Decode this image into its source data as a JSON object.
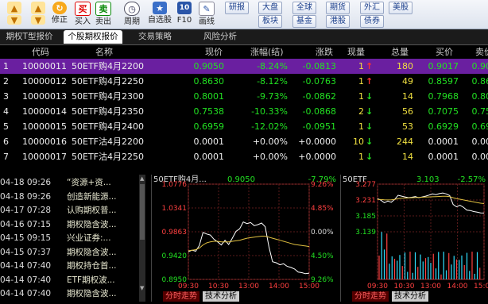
{
  "toolbar": {
    "buttons": [
      {
        "label": "",
        "icon": "arrow-up-icon"
      },
      {
        "label": "修正",
        "icon": "refresh-icon"
      },
      {
        "label": "买入",
        "icon": "buy-icon",
        "glyph": "买"
      },
      {
        "label": "卖出",
        "icon": "sell-icon",
        "glyph": "卖"
      },
      {
        "label": "周期",
        "icon": "clock-icon"
      },
      {
        "label": "自选股",
        "icon": "star-icon"
      },
      {
        "label": "F10",
        "icon": "info-icon",
        "glyph": "10"
      },
      {
        "label": "画线",
        "icon": "pencil-icon"
      }
    ],
    "menu": [
      "研报",
      "大盘",
      "全球",
      "期货",
      "外汇",
      "美股",
      "板块",
      "基金",
      "港股",
      "债券"
    ]
  },
  "tabs": [
    "期权T型报价",
    "个股期权报价",
    "交易策略",
    "风险分析"
  ],
  "table": {
    "headers": [
      "代码",
      "名称",
      "现价",
      "涨幅(结)",
      "涨跌",
      "现量",
      "总量",
      "买价",
      "卖价"
    ],
    "rows": [
      {
        "idx": "1",
        "code": "10000011",
        "name": "50ETF购4月2200",
        "price": "0.9050",
        "pct": "-8.24%",
        "chg": "-0.0813",
        "vol": "1",
        "dir": "up",
        "total": "180",
        "bid": "0.9017",
        "ask": "0.9095"
      },
      {
        "idx": "2",
        "code": "10000012",
        "name": "50ETF购4月2250",
        "price": "0.8630",
        "pct": "-8.12%",
        "chg": "-0.0763",
        "vol": "1",
        "dir": "up",
        "total": "49",
        "bid": "0.8597",
        "ask": "0.8662"
      },
      {
        "idx": "3",
        "code": "10000013",
        "name": "50ETF购4月2300",
        "price": "0.8001",
        "pct": "-9.73%",
        "chg": "-0.0862",
        "vol": "1",
        "dir": "down",
        "total": "14",
        "bid": "0.7968",
        "ask": "0.8032"
      },
      {
        "idx": "4",
        "code": "10000014",
        "name": "50ETF购4月2350",
        "price": "0.7538",
        "pct": "-10.33%",
        "chg": "-0.0868",
        "vol": "2",
        "dir": "down",
        "total": "56",
        "bid": "0.7075",
        "ask": "0.7576"
      },
      {
        "idx": "5",
        "code": "10000015",
        "name": "50ETF购4月2400",
        "price": "0.6959",
        "pct": "-12.02%",
        "chg": "-0.0951",
        "vol": "1",
        "dir": "down",
        "total": "53",
        "bid": "0.6929",
        "ask": "0.6996"
      },
      {
        "idx": "6",
        "code": "10000016",
        "name": "50ETF沽4月2200",
        "price": "0.0001",
        "pct": "+0.00%",
        "chg": "+0.0000",
        "vol": "10",
        "dir": "down",
        "total": "244",
        "bid": "0.0001",
        "ask": "0.0002"
      },
      {
        "idx": "7",
        "code": "10000017",
        "name": "50ETF沽4月2250",
        "price": "0.0001",
        "pct": "+0.00%",
        "chg": "+0.0000",
        "vol": "1",
        "dir": "down",
        "total": "14",
        "bid": "0.0001",
        "ask": "0.0002"
      }
    ]
  },
  "news": [
    {
      "date": "04-18 09:26",
      "title": "“资源+资..."
    },
    {
      "date": "04-18 09:26",
      "title": "创造新能源..."
    },
    {
      "date": "04-17 07:28",
      "title": "认购期权普..."
    },
    {
      "date": "04-16 07:15",
      "title": "期权隐含波..."
    },
    {
      "date": "04-15 09:15",
      "title": "兴业证券:..."
    },
    {
      "date": "04-15 07:37",
      "title": "期权隐含波..."
    },
    {
      "date": "04-14 07:40",
      "title": "期权持仓首..."
    },
    {
      "date": "04-14 07:40",
      "title": "ETF期权波..."
    },
    {
      "date": "04-14 07:40",
      "title": "期权隐含波..."
    }
  ],
  "chart_data": [
    {
      "type": "line",
      "title": "50ETF购4月...",
      "price": "0.9050",
      "change": "-7.79%",
      "ylim": [
        0.895,
        1.0776
      ],
      "y_ticks_left": [
        "1.0776",
        "1.0341",
        "0.9863",
        "0.9420",
        "0.8950"
      ],
      "y_ticks_right": [
        "9.26%",
        "4.85%",
        "0.00%",
        "4.50%",
        "9.26%"
      ],
      "x_ticks": [
        "09:30",
        "10:30",
        "13:00",
        "14:00",
        "15:00"
      ],
      "series": [
        {
          "values": [
            0.948,
            0.951,
            0.949,
            0.96,
            0.985,
            0.982,
            0.98,
            0.972,
            0.967,
            0.961,
            0.97,
            0.962,
            0.974,
            0.987,
            0.992,
            1.005,
            1.002,
            1.004,
            0.998,
            1.0,
            1.003,
            0.996,
            0.958,
            0.929,
            0.927,
            0.923,
            0.925,
            0.92,
            0.918,
            0.915,
            0.909,
            0.908,
            0.906,
            0.907
          ]
        },
        {
          "values": [
            0.95,
            0.951,
            0.952,
            0.955,
            0.961,
            0.965,
            0.967,
            0.968,
            0.968,
            0.967,
            0.967,
            0.967,
            0.968,
            0.969,
            0.97,
            0.972,
            0.974,
            0.975,
            0.976,
            0.977,
            0.978,
            0.978,
            0.976,
            0.974,
            0.972,
            0.97,
            0.968,
            0.966,
            0.964,
            0.962,
            0.961,
            0.96,
            0.959,
            0.958
          ]
        }
      ]
    },
    {
      "type": "line",
      "title": "50ETF",
      "price": "3.103",
      "change": "-2.57%",
      "ylim": [
        2.99,
        3.277
      ],
      "y_ticks_left": [
        "3.277",
        "3.231",
        "3.185",
        "3.139",
        "28706",
        "19137",
        "9568"
      ],
      "x_ticks": [
        "09:30",
        "10:30",
        "13:00",
        "14:00",
        "15:00"
      ],
      "series": [
        {
          "values": [
            3.19,
            3.18,
            3.165,
            3.175,
            3.168,
            3.185,
            3.21,
            3.205,
            3.2,
            3.195,
            3.198,
            3.202,
            3.195,
            3.2,
            3.205,
            3.211,
            3.218,
            3.214,
            3.22,
            3.224,
            3.218,
            3.208,
            3.155,
            3.14,
            3.15,
            3.138,
            3.12,
            3.118,
            3.112,
            3.108,
            3.104,
            3.103
          ]
        },
        {
          "values": [
            3.185,
            3.184,
            3.183,
            3.182,
            3.183,
            3.185,
            3.19,
            3.192,
            3.193,
            3.194,
            3.195,
            3.196,
            3.197,
            3.198,
            3.199,
            3.2,
            3.201,
            3.202,
            3.203,
            3.204,
            3.204,
            3.202,
            3.195,
            3.19,
            3.186,
            3.182,
            3.178,
            3.174,
            3.17,
            3.166,
            3.162,
            3.16
          ]
        }
      ]
    }
  ],
  "panel_tabs": [
    [
      "分时走势",
      "技术分析"
    ],
    [
      "分时走势",
      "技术分析"
    ]
  ]
}
